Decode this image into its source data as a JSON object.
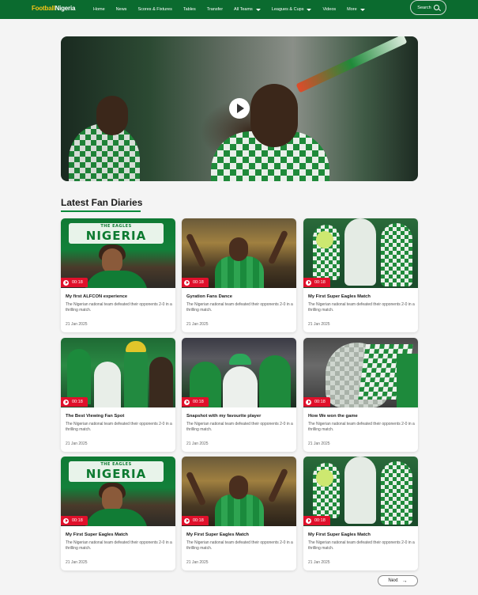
{
  "brand": {
    "logo_part1": "Football",
    "logo_part2": "Nigeria"
  },
  "nav": {
    "items": [
      {
        "label": "Home",
        "dropdown": false
      },
      {
        "label": "News",
        "dropdown": false
      },
      {
        "label": "Scores & Fixtures",
        "dropdown": false
      },
      {
        "label": "Tables",
        "dropdown": false
      },
      {
        "label": "Transfer",
        "dropdown": false
      },
      {
        "label": "All Teams",
        "dropdown": true
      },
      {
        "label": "Leagues & Cups",
        "dropdown": true
      },
      {
        "label": "Videos",
        "dropdown": false
      },
      {
        "label": "More",
        "dropdown": true
      }
    ],
    "search_label": "Search"
  },
  "section": {
    "title": "Latest Fan Diaries"
  },
  "cards": [
    {
      "title": "My first ALFCON experience",
      "description": "The Nigerian national team defeated their opponents 2-0 in a thrilling match.",
      "date": "21 Jan 2025",
      "duration": "00:18",
      "thumb": "nigeria"
    },
    {
      "title": "Gyration Fans Dance",
      "description": "The Nigerian national team defeated their opponents 2-0 in a thrilling match.",
      "date": "21 Jan 2025",
      "duration": "00:18",
      "thumb": "dance"
    },
    {
      "title": "My First Super Eagles Match",
      "description": "The Nigerian national team defeated their opponents 2-0 in a thrilling match.",
      "date": "21 Jan 2025",
      "duration": "00:18",
      "thumb": "eagles"
    },
    {
      "title": "The Best Viewing Fan Spot",
      "description": "The Nigerian national team defeated their opponents 2-0 in a thrilling match.",
      "date": "21 Jan 2025",
      "duration": "00:18",
      "thumb": "crowd"
    },
    {
      "title": "Snapshot with my favourite player",
      "description": "The Nigerian national team defeated their opponents 2-0 in a thrilling match.",
      "date": "21 Jan 2025",
      "duration": "00:18",
      "thumb": "snap"
    },
    {
      "title": "How We won the game",
      "description": "The Nigerian national team defeated their opponents 2-0 in a thrilling match.",
      "date": "21 Jan 2025",
      "duration": "00:18",
      "thumb": "won"
    },
    {
      "title": "My First Super Eagles Match",
      "description": "The Nigerian national team defeated their opponents 2-0 in a thrilling match.",
      "date": "21 Jan 2025",
      "duration": "00:18",
      "thumb": "nigeria"
    },
    {
      "title": "My First Super Eagles Match",
      "description": "The Nigerian national team defeated their opponents 2-0 in a thrilling match.",
      "date": "21 Jan 2025",
      "duration": "00:18",
      "thumb": "dance"
    },
    {
      "title": "My First Super Eagles Match",
      "description": "The Nigerian national team defeated their opponents 2-0 in a thrilling match.",
      "date": "21 Jan 2025",
      "duration": "00:18",
      "thumb": "eagles"
    }
  ],
  "banner_text": {
    "small": "THE EAGLES",
    "big": "NIGERIA"
  },
  "pagination": {
    "next_label": "Next"
  },
  "colors": {
    "brand_green": "#0b6b2f",
    "accent_red": "#e0102b",
    "accent_yellow": "#f5c518"
  }
}
